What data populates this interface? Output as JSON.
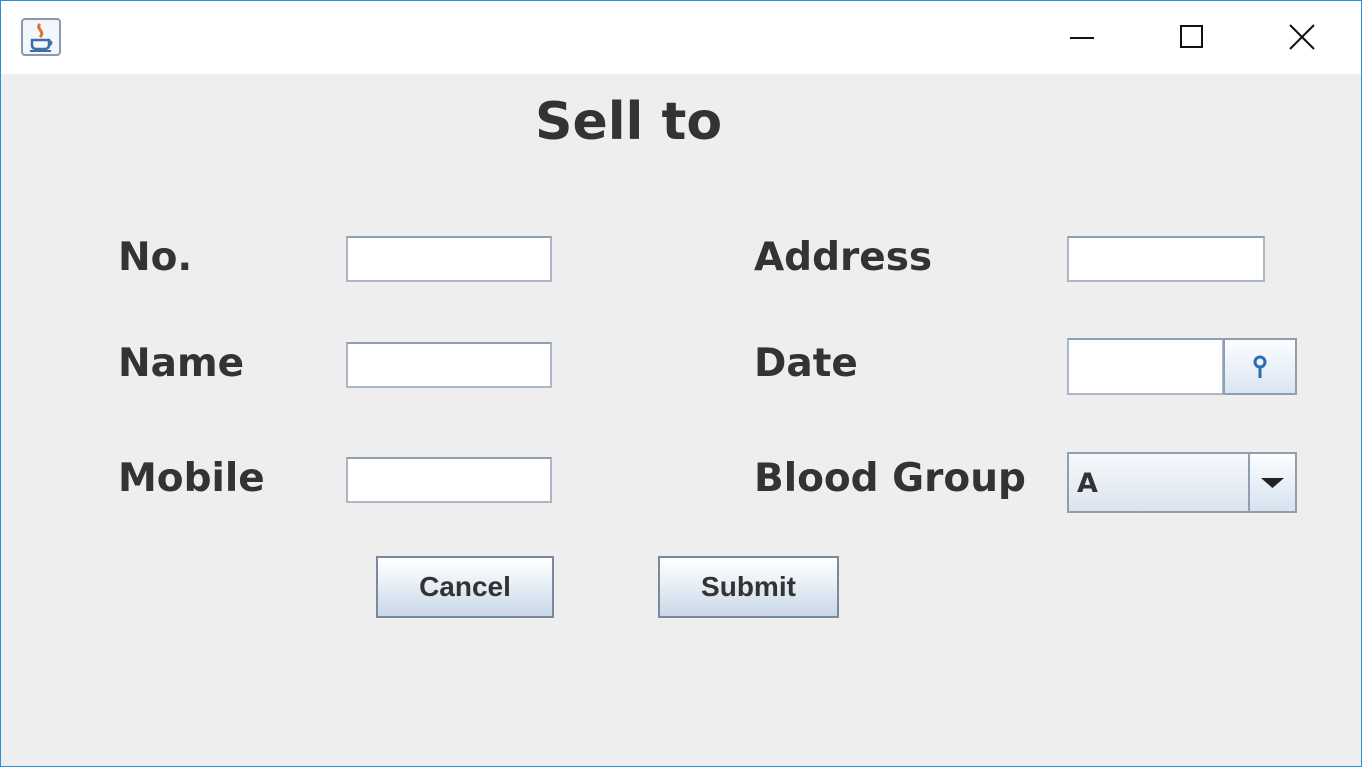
{
  "window": {
    "title": "",
    "controls": {
      "minimize": "minimize-icon",
      "maximize": "maximize-icon",
      "close": "close-icon"
    },
    "app_icon": "java-cup-icon"
  },
  "form": {
    "heading": "Sell to",
    "fields": {
      "no": {
        "label": "No.",
        "value": ""
      },
      "name": {
        "label": "Name",
        "value": ""
      },
      "mobile": {
        "label": "Mobile",
        "value": ""
      },
      "address": {
        "label": "Address",
        "value": ""
      },
      "date": {
        "label": "Date",
        "value": "",
        "picker_icon": "pin-icon"
      },
      "blood_group": {
        "label": "Blood Group",
        "selected": "A",
        "dropdown_icon": "chevron-down-icon"
      }
    },
    "buttons": {
      "cancel": "Cancel",
      "submit": "Submit"
    }
  },
  "colors": {
    "accent": "#2b8fd6",
    "panel_background": "#eeeeee",
    "text": "#333333",
    "field_border": "#8f9eb0"
  }
}
